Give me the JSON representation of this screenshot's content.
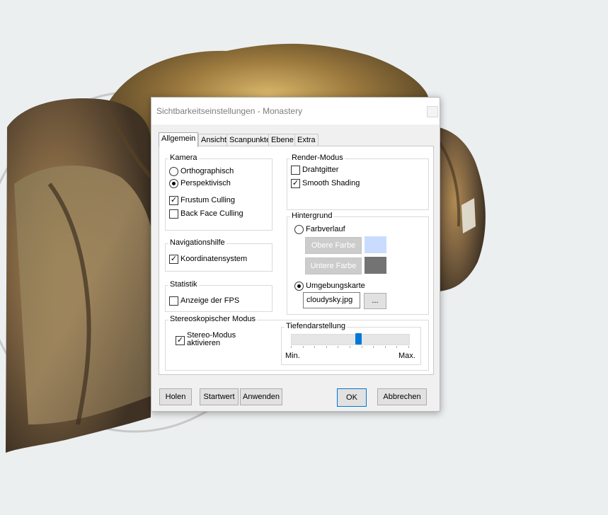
{
  "dialog": {
    "title": "Sichtbarkeitseinstellungen - Monastery"
  },
  "tabs": [
    {
      "label": "Allgemein",
      "active": true
    },
    {
      "label": "Ansicht",
      "active": false
    },
    {
      "label": "Scanpunkte",
      "active": false
    },
    {
      "label": "Ebene",
      "active": false
    },
    {
      "label": "Extra",
      "active": false
    }
  ],
  "kamera": {
    "title": "Kamera",
    "orthographic": {
      "label": "Orthographisch",
      "selected": false
    },
    "perspective": {
      "label": "Perspektivisch",
      "selected": true
    },
    "frustum_culling": {
      "label": "Frustum Culling",
      "checked": true
    },
    "back_face_culling": {
      "label": "Back Face Culling",
      "checked": false
    }
  },
  "render_mode": {
    "title": "Render-Modus",
    "wireframe": {
      "label": "Drahtgitter",
      "checked": false
    },
    "smooth_shading": {
      "label": "Smooth Shading",
      "checked": true
    }
  },
  "navigation": {
    "title": "Navigationshilfe",
    "coordinate_system": {
      "label": "Koordinatensystem",
      "checked": true
    }
  },
  "background": {
    "title": "Hintergrund",
    "gradient": {
      "label": "Farbverlauf",
      "selected": false
    },
    "upper_color": {
      "label": "Obere Farbe",
      "color": "#c9dcff"
    },
    "lower_color": {
      "label": "Untere Farbe",
      "color": "#737373"
    },
    "environment_map": {
      "label": "Umgebungskarte",
      "selected": true
    },
    "environment_file": "cloudysky.jpg",
    "browse_label": "..."
  },
  "statistics": {
    "title": "Statistik",
    "show_fps": {
      "label": "Anzeige der FPS",
      "checked": false
    }
  },
  "stereo": {
    "title": "Stereoskopischer Modus",
    "enable": {
      "label_line1": "Stereo-Modus",
      "label_line2": "aktivieren",
      "checked": true
    },
    "depth": {
      "title": "Tiefendarstellung",
      "min_label": "Min.",
      "max_label": "Max.",
      "value": 0.57
    }
  },
  "buttons": {
    "fetch": "Holen",
    "default": "Startwert",
    "apply": "Anwenden",
    "ok": "OK",
    "cancel": "Abbrechen"
  },
  "colors": {
    "accent": "#0078d7",
    "check": "#000000"
  }
}
